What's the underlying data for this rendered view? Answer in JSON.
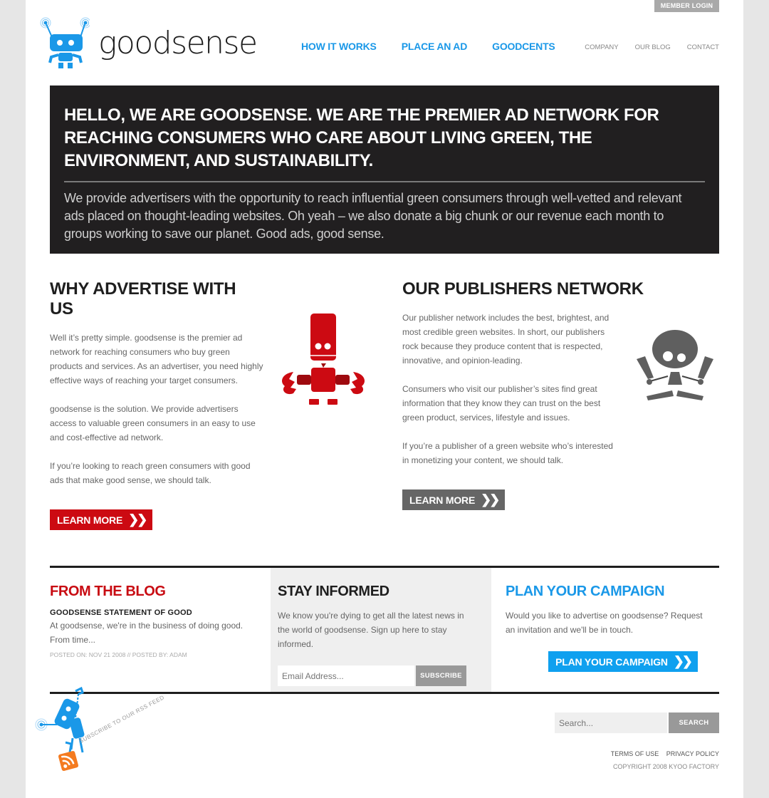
{
  "header": {
    "member_login": "MEMBER LOGIN",
    "logo_text": "goodsense",
    "main_nav": [
      {
        "label": "HOW IT WORKS"
      },
      {
        "label": "PLACE AN AD"
      },
      {
        "label": "GOODCENTS"
      }
    ],
    "sub_nav": [
      {
        "label": "COMPANY"
      },
      {
        "label": "OUR BLOG"
      },
      {
        "label": "CONTACT"
      }
    ]
  },
  "hero": {
    "headline": "HELLO, WE ARE GOODSENSE. WE ARE THE PREMIER AD NETWORK FOR REACHING CONSUMERS WHO CARE ABOUT LIVING GREEN, THE ENVIRONMENT, AND SUSTAINABILITY.",
    "body": "We provide advertisers with the opportunity to reach influential green consumers through well-vetted and relevant ads placed on thought-leading websites. Oh yeah – we also donate a big chunk or our revenue each month to groups working to save our planet. Good ads, good sense."
  },
  "advertise": {
    "title": "WHY ADVERTISE WITH US",
    "paragraphs": [
      "Well it’s pretty simple. goodsense is the premier ad network for reaching consumers who buy green products and services. As an advertiser, you need highly effective ways of reaching your target consumers.",
      "goodsense is the solution. We provide advertisers access to valuable green consumers in an easy to use and cost-effective ad network.",
      "If you’re looking to reach green consumers with good ads that make good sense, we should talk."
    ],
    "button": "LEARN MORE",
    "button_icon": "❯❯"
  },
  "publishers": {
    "title": "OUR PUBLISHERS NETWORK",
    "paragraphs": [
      "Our publisher network includes the best, brightest, and most credible green websites. In short, our publishers rock because they produce content that is respected, innovative, and opinion-leading.",
      "Consumers who visit our publisher’s sites find great information that they know they can trust on the best green product, services, lifestyle and issues.",
      "If you’re a publisher of a green website who’s interested in monetizing your content, we should talk."
    ],
    "button": "LEARN MORE",
    "button_icon": "❯❯"
  },
  "blog": {
    "title": "FROM THE BLOG",
    "post_title": "GOODSENSE STATEMENT OF GOOD",
    "excerpt": "At goodsense, we're in the business of doing good. From time...",
    "meta": "POSTED ON: NOV 21 2008 // POSTED BY: ADAM"
  },
  "stay_informed": {
    "title": "STAY INFORMED",
    "body": "We know you're dying to get all the latest news in the world of goodsense. Sign up here to stay informed.",
    "email_placeholder": "Email Address...",
    "email_value": "",
    "subscribe": "SUBSCRIBE"
  },
  "plan": {
    "title": "PLAN YOUR CAMPAIGN",
    "body": "Would you like to advertise on goodsense? Request an invitation and we'll be in touch.",
    "button": "PLAN YOUR CAMPAIGN",
    "button_icon": "❯❯"
  },
  "footer": {
    "rss_label": "SUBSCRIBE TO OUR RSS FEED",
    "search_placeholder": "Search...",
    "search_value": "",
    "search_button": "SEARCH",
    "links": [
      {
        "label": "TERMS OF USE"
      },
      {
        "label": "PRIVACY POLICY"
      }
    ],
    "copyright": "COPYRIGHT 2008 KYOO FACTORY"
  },
  "colors": {
    "brand_blue": "#1a98e8",
    "brand_red": "#cc0a12",
    "dark": "#211f20",
    "gray_button": "#666666"
  }
}
